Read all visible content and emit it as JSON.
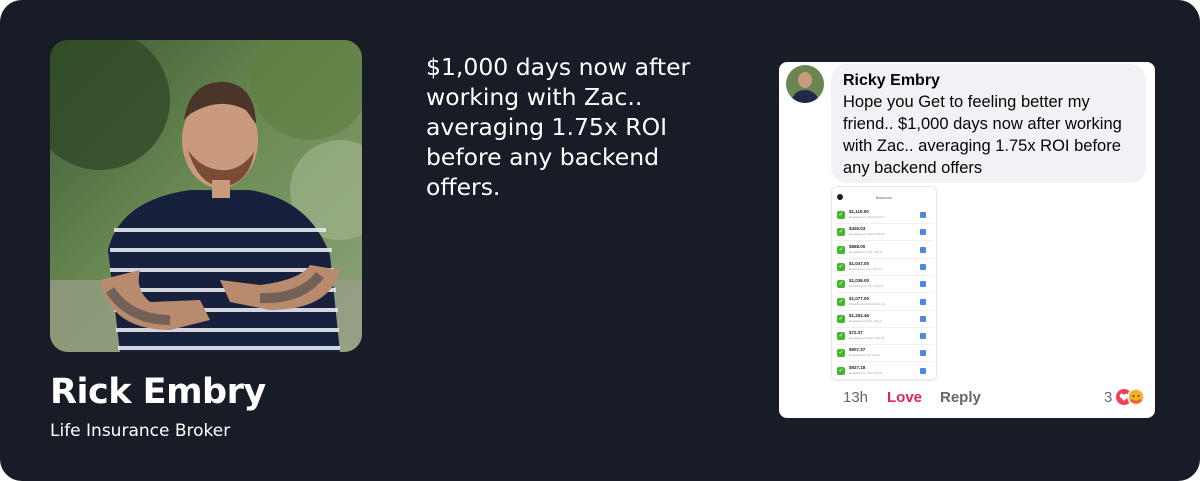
{
  "profile": {
    "name": "Rick Embry",
    "role": "Life Insurance Broker"
  },
  "quote": {
    "text": "$1,000 days now after working with Zac.. averaging 1.75x ROI before any backend offers."
  },
  "comment": {
    "author": "Ricky Embry",
    "text": "Hope you Get to feeling better my friend.. $1,000 days now after working with Zac.. averaging 1.75x ROI before any backend offers",
    "attachment": {
      "title": "Balances",
      "rows": [
        {
          "amount": "$1,110.00",
          "sub": "Deposited on Thu, Feb 22"
        },
        {
          "amount": "$426.03",
          "sub": "Deposited on Wed, Feb 20"
        },
        {
          "amount": "$868.00",
          "sub": "Deposited on Tue, Feb 6"
        },
        {
          "amount": "$1,047.00",
          "sub": "Deposited on Fri, Feb 11"
        },
        {
          "amount": "$1,036.00",
          "sub": "Deposited on Thu, Feb 14"
        },
        {
          "amount": "$1,077.00",
          "sub": "Deposited on Wed, Feb 13"
        },
        {
          "amount": "$1,204.46",
          "sub": "Deposited on Tue, Feb 6"
        },
        {
          "amount": "$72.37",
          "sub": "Deposited on Mon, Feb 12"
        },
        {
          "amount": "$907.37",
          "sub": "Deposited on Fri, Feb 9"
        },
        {
          "amount": "$927.18",
          "sub": "Deposited on Thu, Feb 8"
        }
      ]
    },
    "time": "13h",
    "love_label": "Love",
    "reply_label": "Reply",
    "reaction_count": "3",
    "reaction_icons": [
      "love-reaction-icon",
      "care-reaction-icon"
    ]
  },
  "colors": {
    "background": "#171c26",
    "love": "#e0245e",
    "bubble": "#f0f2f5"
  }
}
